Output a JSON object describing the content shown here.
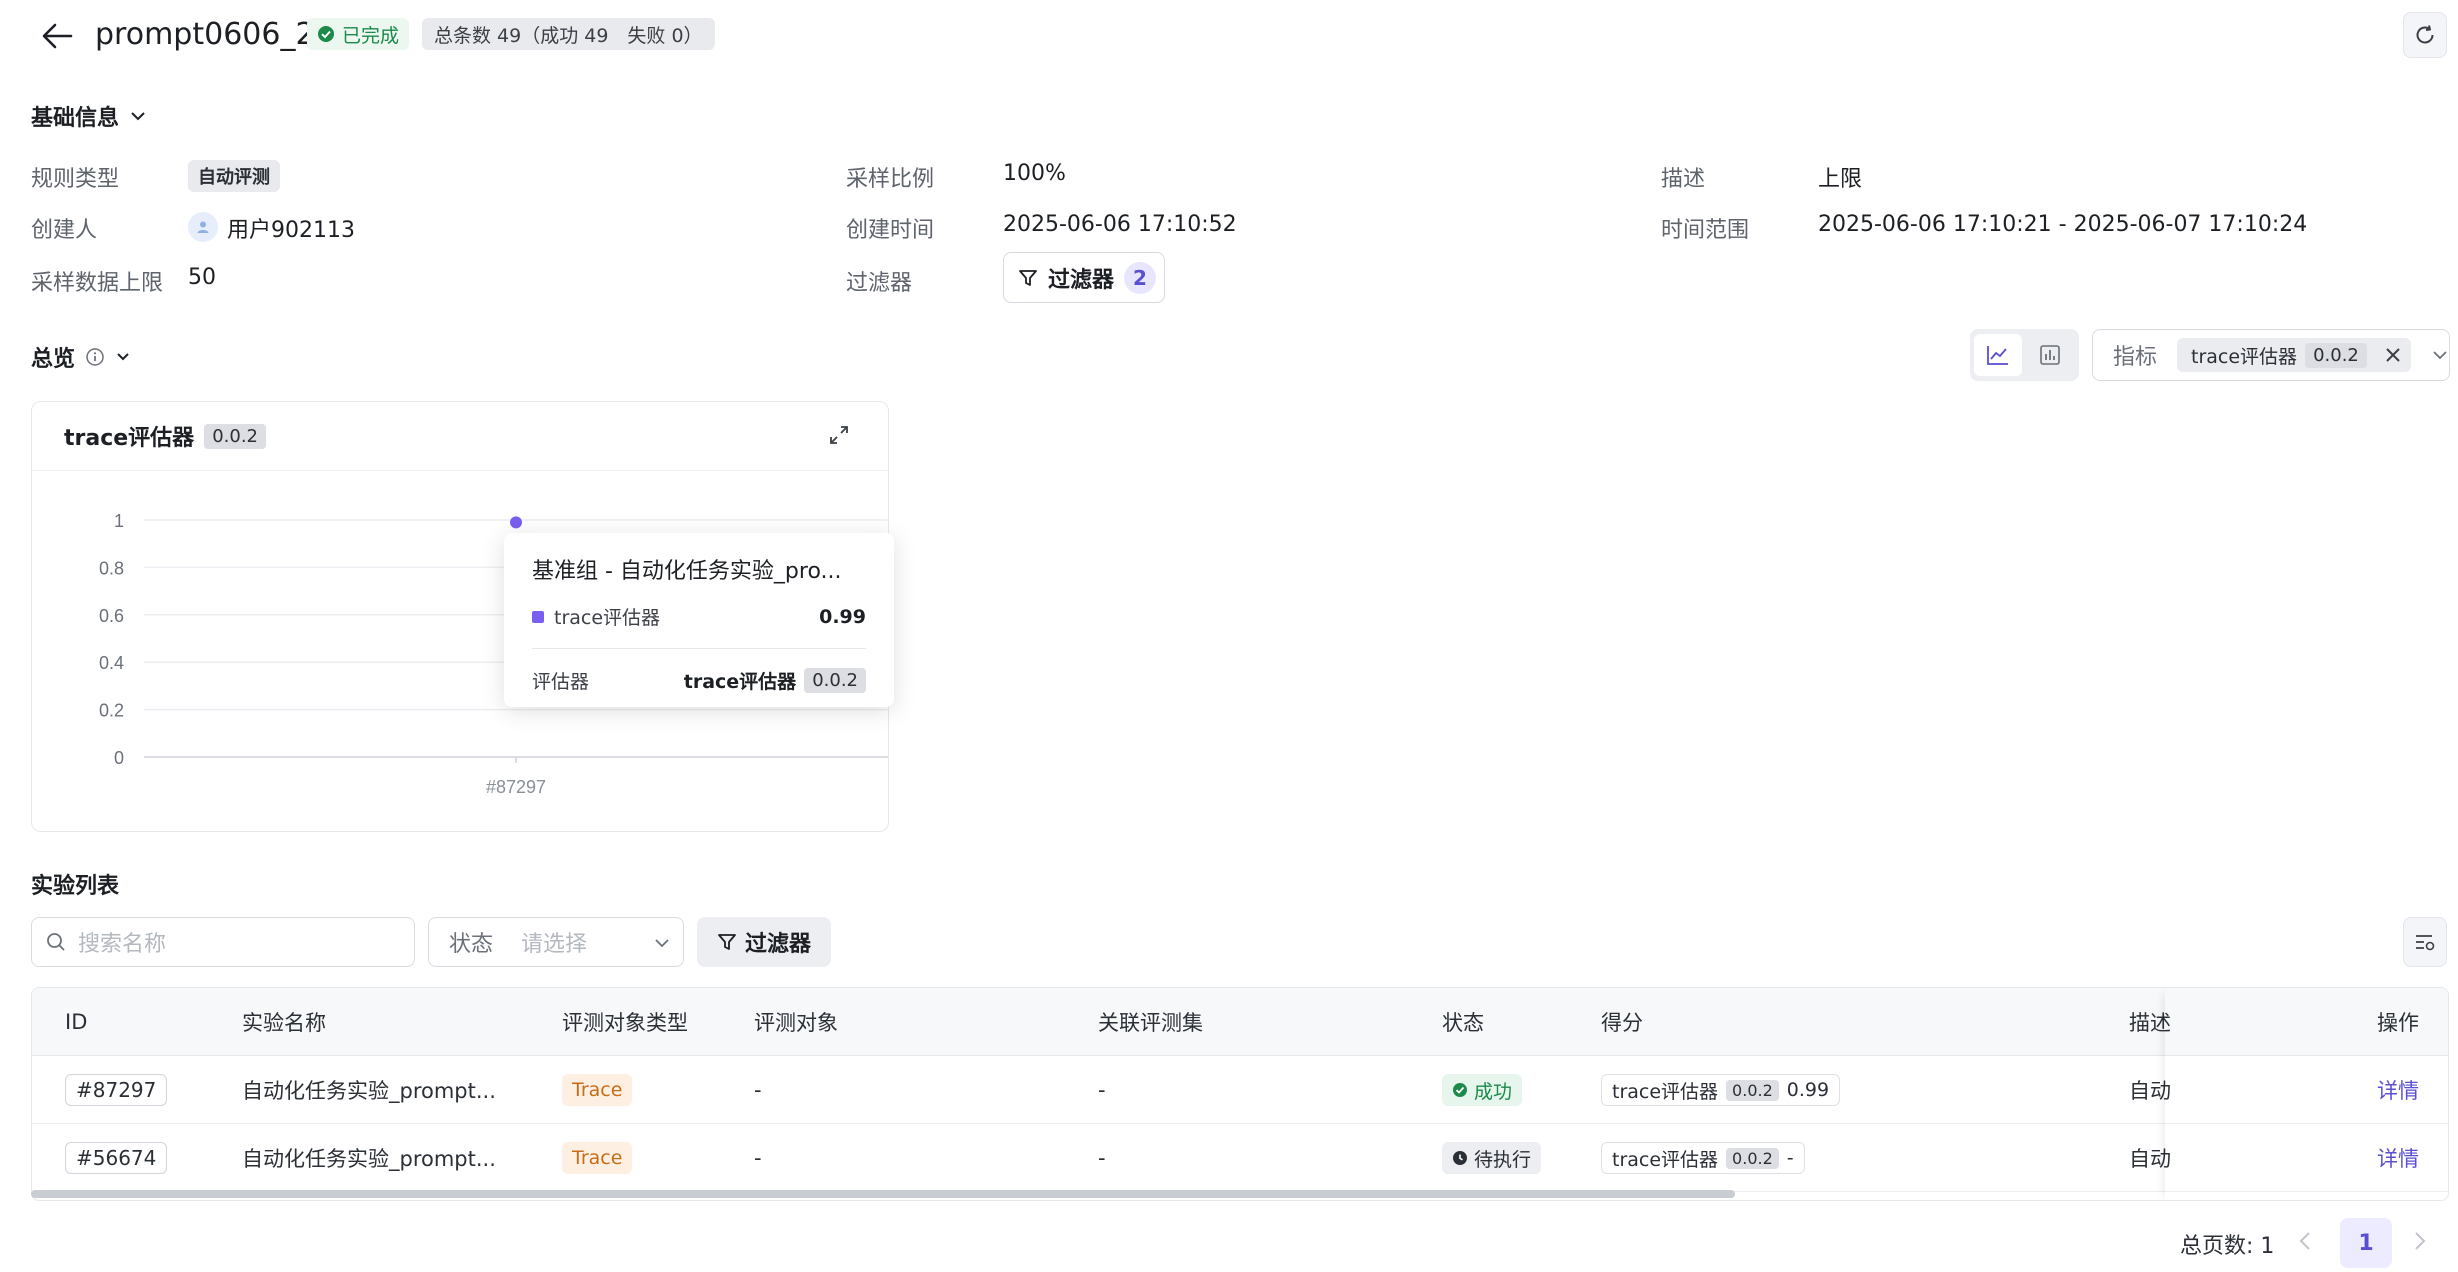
{
  "header": {
    "title": "prompt0606_2",
    "status": "已完成",
    "total": "总条数 49（成功 49　失败 0）"
  },
  "basic": {
    "section_title": "基础信息",
    "rule_type_label": "规则类型",
    "rule_type_value": "自动评测",
    "creator_label": "创建人",
    "creator_value": "用户902113",
    "limit_label": "采样数据上限",
    "limit_value": "50",
    "ratio_label": "采样比例",
    "ratio_value": "100%",
    "created_label": "创建时间",
    "created_value": "2025-06-06 17:10:52",
    "filter_label": "过滤器",
    "filter_button": "过滤器",
    "filter_count": "2",
    "desc_label": "描述",
    "desc_value": "上限",
    "range_label": "时间范围",
    "range_value": "2025-06-06 17:10:21 - 2025-06-07 17:10:24"
  },
  "overview": {
    "section_title": "总览",
    "metric_label": "指标",
    "metric_chip": "trace评估器",
    "metric_version": "0.0.2"
  },
  "chart_card": {
    "title": "trace评估器",
    "version": "0.0.2"
  },
  "chart_data": {
    "type": "scatter",
    "title": "trace评估器",
    "categories": [
      "#87297"
    ],
    "series": [
      {
        "name": "trace评估器",
        "values": [
          0.99
        ]
      }
    ],
    "ylim": [
      0,
      1
    ],
    "yticks": [
      "1",
      "0.8",
      "0.6",
      "0.4",
      "0.2",
      "0"
    ],
    "grid": true,
    "color": "#7a5ef0"
  },
  "tooltip": {
    "title": "基准组 - 自动化任务实验_pro...",
    "series_name": "trace评估器",
    "series_value": "0.99",
    "evaluator_label": "评估器",
    "evaluator_name": "trace评估器",
    "evaluator_version": "0.0.2"
  },
  "list": {
    "section_title": "实验列表",
    "search_placeholder": "搜索名称",
    "status_label": "状态",
    "status_placeholder": "请选择",
    "filter_button": "过滤器",
    "columns": [
      "ID",
      "实验名称",
      "评测对象类型",
      "评测对象",
      "关联评测集",
      "状态",
      "得分",
      "描述",
      "操作"
    ],
    "rows": [
      {
        "id": "#87297",
        "name": "自动化任务实验_prompt...",
        "type": "Trace",
        "target": "-",
        "dataset": "-",
        "status": "成功",
        "score_name": "trace评估器",
        "score_version": "0.0.2",
        "score": "0.99",
        "desc": "自动",
        "action": "详情"
      },
      {
        "id": "#56674",
        "name": "自动化任务实验_prompt...",
        "type": "Trace",
        "target": "-",
        "dataset": "-",
        "status": "待执行",
        "score_name": "trace评估器",
        "score_version": "0.0.2",
        "score": "-",
        "desc": "自动",
        "action": "详情"
      }
    ]
  },
  "pagination": {
    "total_label": "总页数: 1",
    "current": "1"
  },
  "colors": {
    "accent": "#5a4fd1",
    "success": "#1b8a4a",
    "trace_tag": "#c66d18"
  }
}
